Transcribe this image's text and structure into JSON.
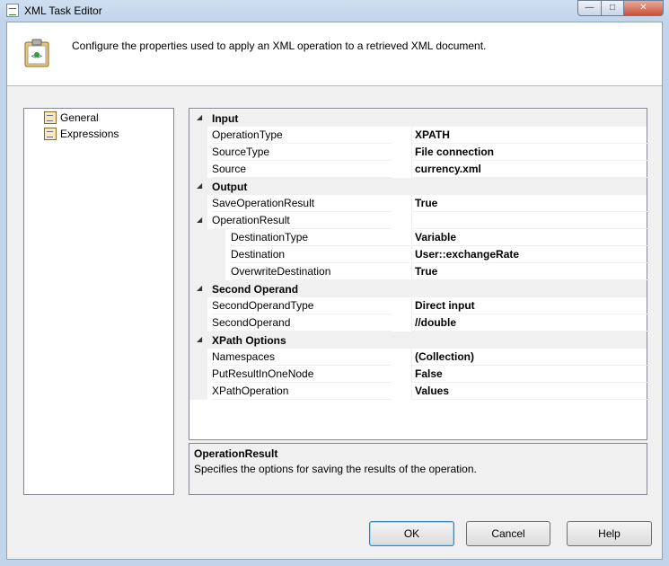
{
  "window": {
    "title": "XML Task Editor"
  },
  "header": {
    "text": "Configure the properties used to apply an XML operation to a retrieved XML document."
  },
  "nav": {
    "items": [
      {
        "label": "General"
      },
      {
        "label": "Expressions"
      }
    ]
  },
  "grid": {
    "rows": [
      {
        "type": "category",
        "name": "Input"
      },
      {
        "type": "prop",
        "name": "OperationType",
        "value": "XPATH"
      },
      {
        "type": "prop",
        "name": "SourceType",
        "value": "File connection"
      },
      {
        "type": "prop",
        "name": "Source",
        "value": "currency.xml"
      },
      {
        "type": "category",
        "name": "Output"
      },
      {
        "type": "prop",
        "name": "SaveOperationResult",
        "value": "True"
      },
      {
        "type": "group",
        "name": "OperationResult",
        "value": ""
      },
      {
        "type": "sub",
        "name": "DestinationType",
        "value": "Variable"
      },
      {
        "type": "sub",
        "name": "Destination",
        "value": "User::exchangeRate"
      },
      {
        "type": "sub",
        "name": "OverwriteDestination",
        "value": "True"
      },
      {
        "type": "category",
        "name": "Second Operand"
      },
      {
        "type": "prop",
        "name": "SecondOperandType",
        "value": "Direct input"
      },
      {
        "type": "prop",
        "name": "SecondOperand",
        "value": "//double"
      },
      {
        "type": "category",
        "name": "XPath Options"
      },
      {
        "type": "prop",
        "name": "Namespaces",
        "value": "(Collection)"
      },
      {
        "type": "prop",
        "name": "PutResultInOneNode",
        "value": "False"
      },
      {
        "type": "prop",
        "name": "XPathOperation",
        "value": "Values"
      }
    ]
  },
  "description": {
    "title": "OperationResult",
    "text": "Specifies the options for saving the results of the operation."
  },
  "buttons": {
    "ok": "OK",
    "cancel": "Cancel",
    "help": "Help"
  },
  "colors": {
    "accent": "#3c7fb1",
    "category_bg": "#f0f0f0"
  }
}
